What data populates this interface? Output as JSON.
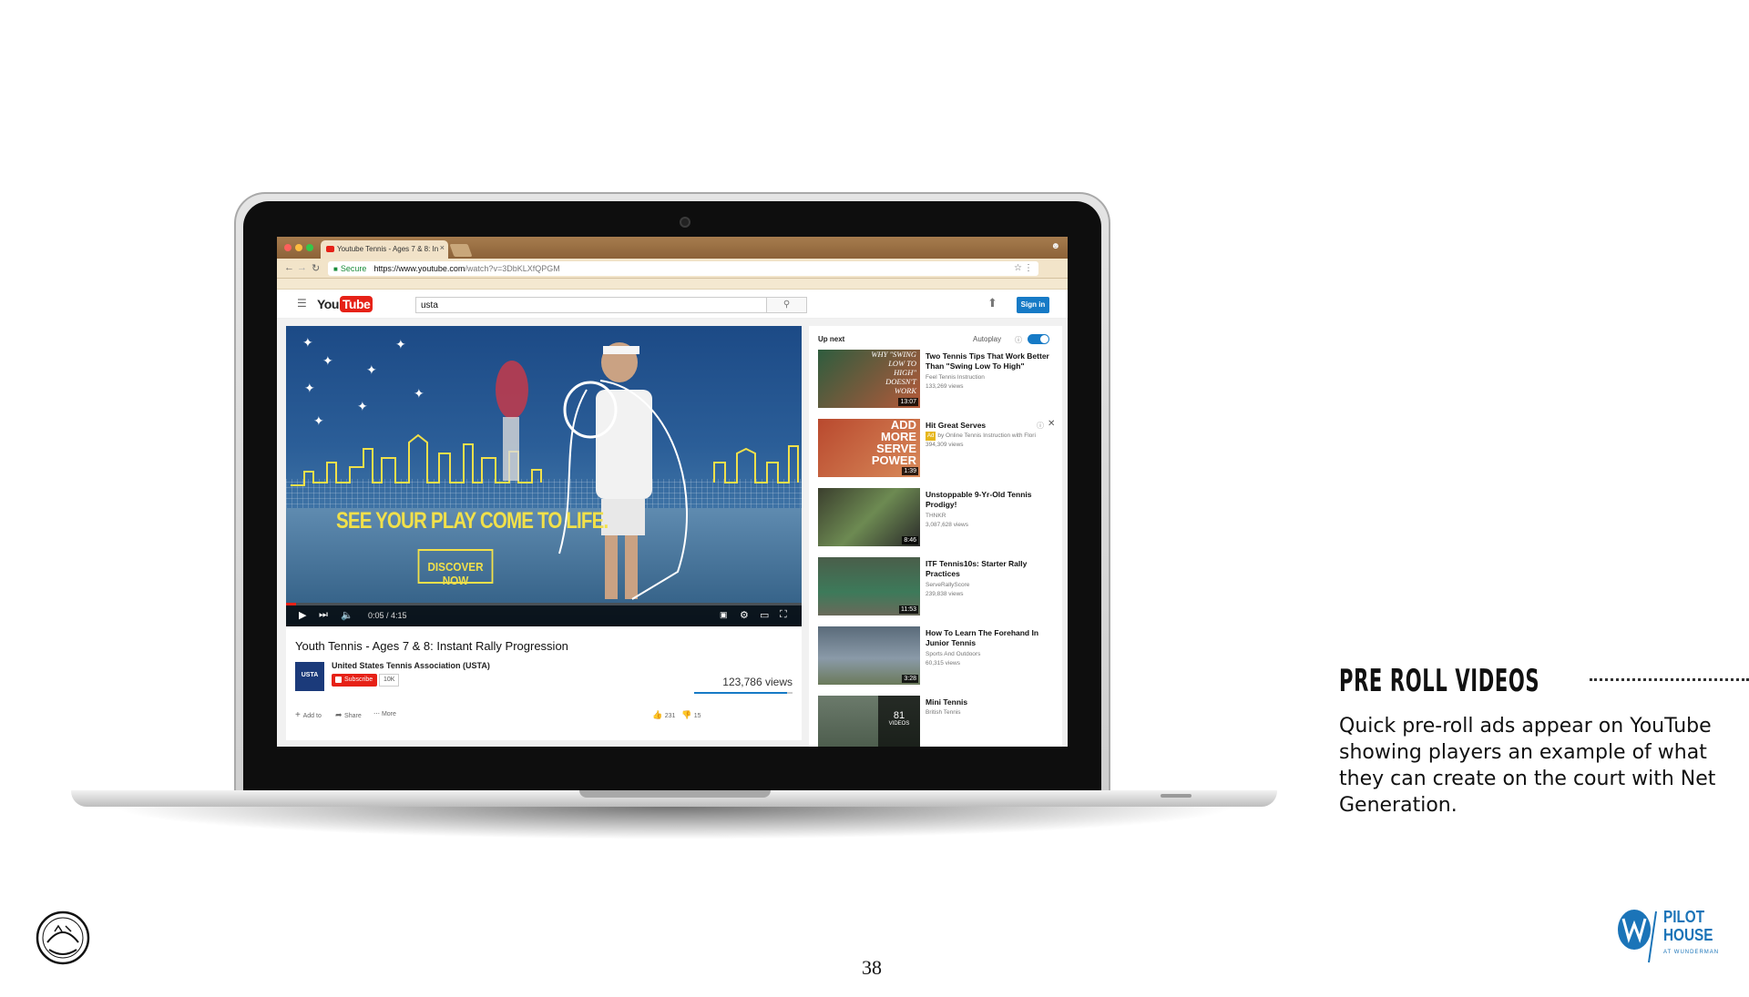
{
  "browser": {
    "tab_title": "Youtube Tennis - Ages 7 & 8: In",
    "tab_close": "×",
    "secure_label": "Secure",
    "url_host": "https://www.youtube.com",
    "url_path": "/watch?v=3DbKLXfQPGM"
  },
  "youtube": {
    "search_value": "usta",
    "sign_in": "Sign in",
    "logo_you": "You",
    "logo_tube": "Tube"
  },
  "player": {
    "headline": "SEE YOUR PLAY COME TO LIFE.",
    "cta": "DISCOVER NOW",
    "time": "0:05 / 4:15",
    "progress_fraction": 0.02
  },
  "video": {
    "title": "Youth Tennis - Ages 7 & 8: Instant Rally Progression",
    "channel": "United States Tennis Association (USTA)",
    "channel_logo": "USTA",
    "subscribe": "Subscribe",
    "subscriber_count": "10K",
    "views": "123,786 views",
    "add_to": "Add to",
    "share": "Share",
    "more": "More",
    "likes": "231",
    "dislikes": "15",
    "like_ratio": 0.94
  },
  "sidebar": {
    "up_next": "Up next",
    "autoplay": "Autoplay",
    "autoplay_on": true,
    "recommendations": [
      {
        "title": "Two Tennis Tips That Work Better Than \"Swing Low To High\"",
        "channel": "Feel Tennis Instruction",
        "views": "133,269 views",
        "duration": "13:07",
        "thumb_text": "WHY \"SWING LOW TO HIGH\" DOESN'T WORK"
      },
      {
        "title": "Hit Great Serves",
        "ad_label": "Ad",
        "channel": "by Online Tennis Instruction with Flori",
        "views": "394,309 views",
        "duration": "1:39",
        "thumb_text": "ADD MORE SERVE POWER"
      },
      {
        "title": "Unstoppable 9-Yr-Old Tennis Prodigy!",
        "channel": "THNKR",
        "views": "3,087,628 views",
        "duration": "8:46"
      },
      {
        "title": "ITF Tennis10s: Starter Rally Practices",
        "channel": "ServeRallyScore",
        "views": "239,838 views",
        "duration": "11:53"
      },
      {
        "title": "How To Learn The Forehand In Junior Tennis",
        "channel": "Sports And Outdoors",
        "views": "60,315 views",
        "duration": "3:28"
      },
      {
        "title": "Mini Tennis",
        "channel": "British Tennis",
        "playlist_count": "81",
        "playlist_label": "VIDEOS"
      }
    ]
  },
  "slide": {
    "heading": "PRE ROLL VIDEOS",
    "body": "Quick pre-roll ads appear on YouTube showing players an example of what they can create on the court with Net Generation.",
    "page_number": "38",
    "pilot_logo_line1": "PILOT",
    "pilot_logo_line2": "HOUSE",
    "pilot_logo_sub": "AT WUNDERMAN"
  },
  "colors": {
    "youtube_red": "#e62117",
    "youtube_blue": "#167ac6",
    "ad_yellow": "#f1e04a",
    "pilot_blue": "#1b74b8"
  }
}
